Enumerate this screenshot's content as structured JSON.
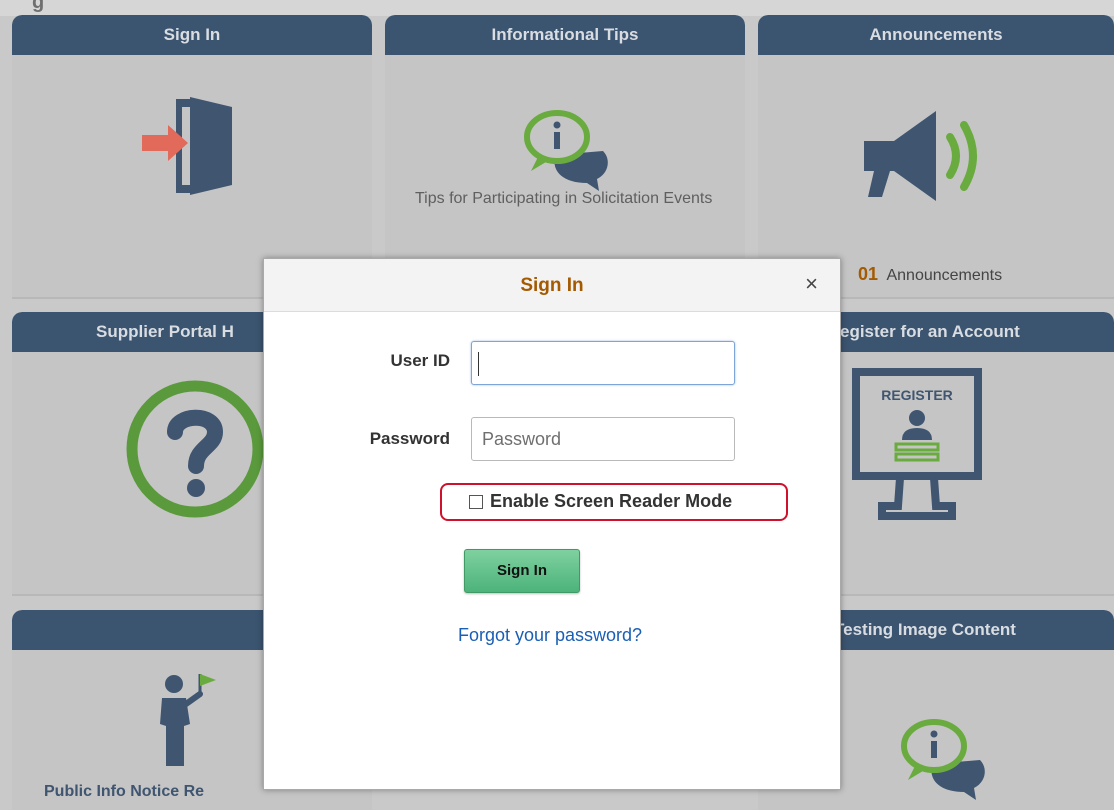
{
  "page": {
    "heading_fragment": "g"
  },
  "tiles": {
    "sign_in": {
      "title": "Sign In"
    },
    "informational_tips": {
      "title": "Informational Tips",
      "text": "Tips for Participating in Solicitation Events"
    },
    "announcements": {
      "title": "Announcements",
      "count": "01",
      "text": "Announcements"
    },
    "supplier_portal_help": {
      "title": "Supplier Portal H"
    },
    "register": {
      "title": "egister for an Account",
      "monitor_label": "REGISTER"
    },
    "public_info": {
      "title": "",
      "text": "Public Info Notice Re"
    },
    "testing_image": {
      "title": "Testing Image Content"
    }
  },
  "modal": {
    "title": "Sign In",
    "close_glyph": "×",
    "user_id": {
      "label": "User ID",
      "value": "",
      "placeholder": ""
    },
    "password": {
      "label": "Password",
      "value": "",
      "placeholder": "Password"
    },
    "screen_reader": {
      "label": "Enable Screen Reader Mode",
      "checked": false
    },
    "submit_label": "Sign In",
    "forgot_link": "Forgot your password?"
  },
  "colors": {
    "tile_header": "#3b5470",
    "modal_title": "#a45a00",
    "button_green": "#4cb37a",
    "link_blue": "#1a5fb4",
    "highlight_red": "#d0112b",
    "help_ring_green": "#5a9a3c"
  },
  "icons": {
    "sign_in": "door-arrow-icon",
    "tips": "info-speech-bubble-icon",
    "announcements": "megaphone-icon",
    "help": "question-circle-icon",
    "register": "register-monitor-icon",
    "public_info": "person-flag-icon",
    "testing": "info-speech-bubble-icon"
  }
}
